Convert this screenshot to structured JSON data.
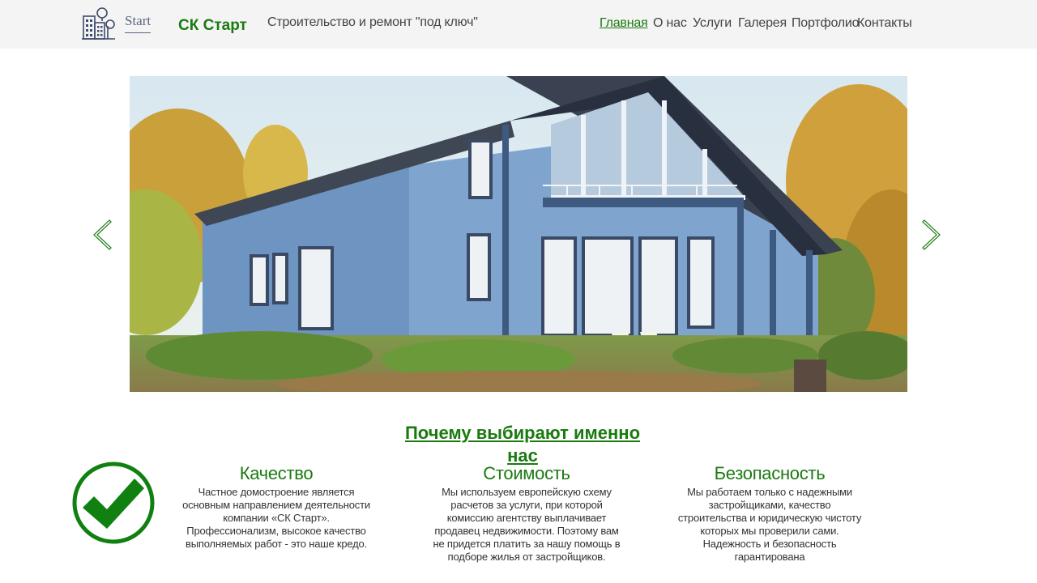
{
  "header": {
    "logo_text": "Start",
    "brand": "СК Старт",
    "tagline": "Строительство и ремонт \"под ключ\""
  },
  "nav": {
    "items": [
      {
        "label": "Главная",
        "active": true
      },
      {
        "label": "О нас"
      },
      {
        "label": "Услуги"
      },
      {
        "label": "Галерея"
      },
      {
        "label": "Портфолио"
      },
      {
        "label": "Контакты"
      }
    ]
  },
  "section": {
    "title": "Почему выбирают именно нас"
  },
  "features": [
    {
      "title": "Качество",
      "text": "Частное домостроение является основным направлением деятельности компании «СК Старт». Профессионализм, высокое качество выполняемых работ - это наше кредо."
    },
    {
      "title": "Стоимость",
      "text": "Мы используем европейскую схему расчетов за услуги, при которой комиссию агентству выплачивает продавец недвижимости. Поэтому вам не придется платить за нашу помощь в подборе жилья от застройщиков."
    },
    {
      "title": "Безопасность",
      "text": "Мы работаем только с надежными застройщиками, качество строительства и юридическую чистоту которых мы проверили сами. Надежность и безопасность гарантирована"
    }
  ],
  "colors": {
    "accent": "#1a7a10",
    "header_bg": "#f4f4f4"
  }
}
